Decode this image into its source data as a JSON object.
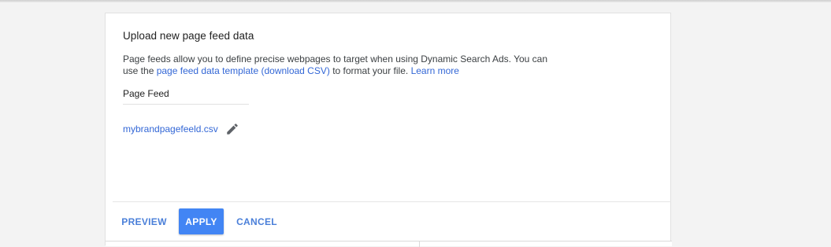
{
  "dialog": {
    "title": "Upload new page feed data",
    "description": {
      "text_before": "Page feeds allow you to define precise webpages to target when using Dynamic Search Ads. You can use the ",
      "template_link": "page feed data template (download CSV)",
      "text_after": " to format your file. ",
      "learn_more_link": "Learn more"
    },
    "field": {
      "label": "Page Feed",
      "file_name": "mybrandpagefeeld.csv",
      "edit_icon": "pencil-icon"
    }
  },
  "footer": {
    "preview_label": "PREVIEW",
    "apply_label": "APPLY",
    "cancel_label": "CANCEL"
  },
  "colors": {
    "link": "#3367d6",
    "primary_button": "#4285f4",
    "flat_button_text": "#4a7fd9",
    "background": "#f3f3f3"
  }
}
